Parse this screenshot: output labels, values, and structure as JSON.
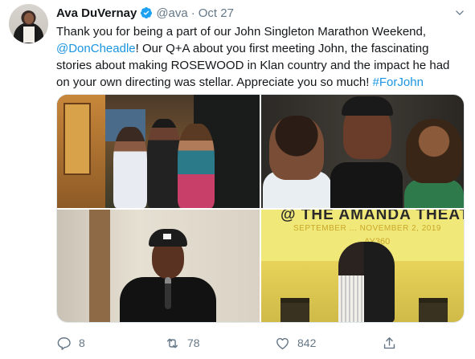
{
  "author": {
    "name": "Ava DuVernay",
    "handle": "@ava",
    "separator": "·",
    "date": "Oct 27"
  },
  "tweet": {
    "text_part1": "Thank you for being a part of our John Singleton Marathon Weekend, ",
    "mention": "@DonCheadle",
    "text_part2": "! Our Q+A about you first meeting John, the fascinating stories about making ROSEWOOD in Klan country and the impact he had on your own directing was stellar. Appreciate you so much! ",
    "hashtag": "#ForJohn"
  },
  "media": {
    "photo4_sign_title": "@ THE AMANDA THEATER",
    "photo4_sign_sub": "SEPTEMBER ... NOVEMBER 2, 2019",
    "photo4_sign_brand": "AY360"
  },
  "actions": {
    "reply_count": "8",
    "retweet_count": "78",
    "like_count": "842"
  },
  "icons": {
    "verified": "verified-badge-icon",
    "menu": "chevron-down-icon",
    "reply": "reply-icon",
    "retweet": "retweet-icon",
    "like": "heart-icon",
    "share": "share-icon"
  },
  "colors": {
    "link": "#1b95e0",
    "verified": "#1da1f2",
    "secondary_text": "#657786"
  }
}
